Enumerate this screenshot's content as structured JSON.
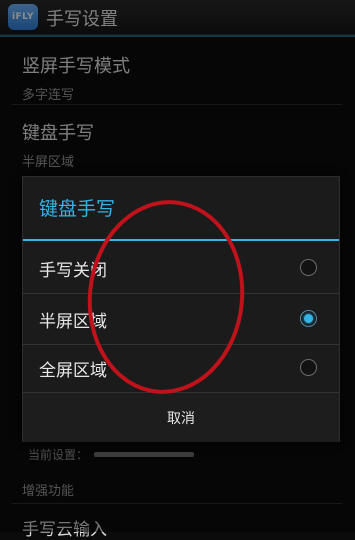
{
  "titlebar": {
    "icon_text": "iFLY",
    "title": "手写设置"
  },
  "prefs": [
    {
      "title": "竖屏手写模式",
      "summary": "多字连写"
    },
    {
      "title": "键盘手写",
      "summary": "半屏区域"
    }
  ],
  "dialog": {
    "title": "键盘手写",
    "options": [
      {
        "label": "手写关闭",
        "selected": false
      },
      {
        "label": "半屏区域",
        "selected": true
      },
      {
        "label": "全屏区域",
        "selected": false
      }
    ],
    "cancel": "取消"
  },
  "below": {
    "current_label": "当前设置：",
    "section_header": "增强功能",
    "next_item": "手写云输入"
  },
  "colors": {
    "accent": "#33b5e5",
    "annotation": "#c0121b"
  }
}
